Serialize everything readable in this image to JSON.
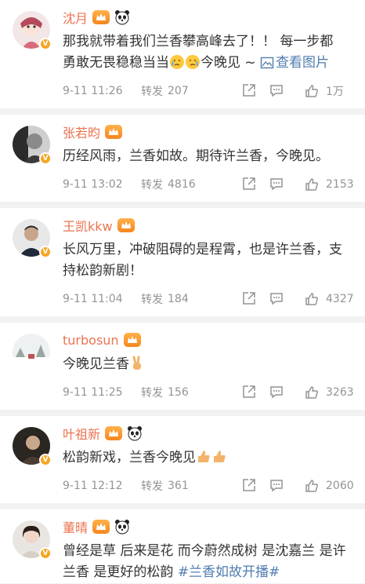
{
  "colors": {
    "username": "#eb7350",
    "link": "#507daf",
    "meta": "#939393",
    "crown_badge": "#f5861f",
    "verified_badge": "#f6a623"
  },
  "icons": {
    "share": "share-icon",
    "comment": "comment-icon",
    "like": "thumbs-up-icon",
    "crown": "crown-badge-icon",
    "panda": "panda-icon",
    "image": "image-icon"
  },
  "comments": [
    {
      "username": "沈月",
      "content_text": "那我就带着我们兰香攀高峰去了！！ 每一步都勇敢无畏稳稳当当",
      "content_tail": "今晚见 ~ ",
      "link_text": "查看图片",
      "time": "9-11 11:26",
      "repost_label": "转发",
      "repost_count": "207",
      "like_count": "1万"
    },
    {
      "username": "张若昀",
      "content_text": "历经风雨，兰香如故。期待许兰香，今晚见。",
      "time": "9-11 13:02",
      "repost_label": "转发",
      "repost_count": "4816",
      "like_count": "2153"
    },
    {
      "username": "王凯kkw",
      "content_text": "长风万里，冲破阻碍的是程霄，也是许兰香，支持松韵新剧！",
      "time": "9-11 11:04",
      "repost_label": "转发",
      "repost_count": "184",
      "like_count": "4327"
    },
    {
      "username": "turbosun",
      "content_text": "今晚见兰香",
      "time": "9-11 11:25",
      "repost_label": "转发",
      "repost_count": "156",
      "like_count": "3263"
    },
    {
      "username": "叶祖新",
      "content_text": "松韵新戏，兰香今晚见",
      "time": "9-11 12:12",
      "repost_label": "转发",
      "repost_count": "361",
      "like_count": "2060"
    },
    {
      "username": "董晴",
      "content_text": "曾经是草 后来是花 而今蔚然成树 是沈嘉兰 是许兰香 是更好的松韵 ",
      "link_text": "#兰香如故开播#"
    }
  ]
}
